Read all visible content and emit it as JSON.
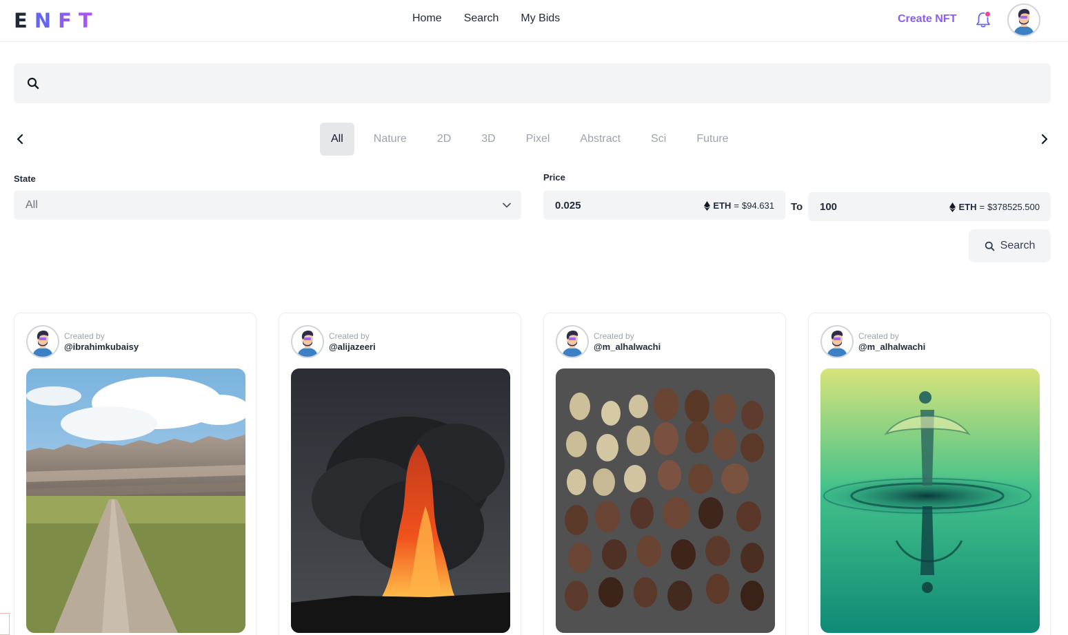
{
  "header": {
    "logo": {
      "letters": [
        "E",
        "N",
        "F",
        "T"
      ],
      "colors": [
        "#1f2937",
        "#6366f1",
        "#8b5cf6",
        "#a855f7"
      ]
    },
    "nav": [
      {
        "label": "Home"
      },
      {
        "label": "Search"
      },
      {
        "label": "My Bids"
      }
    ],
    "create_label": "Create NFT",
    "notification_icon": "bell-icon",
    "accent_color": "#8b5cf6"
  },
  "search": {
    "placeholder": "",
    "value": "",
    "icon": "search-icon"
  },
  "categories": {
    "items": [
      "All",
      "Nature",
      "2D",
      "3D",
      "Pixel",
      "Abstract",
      "Sci",
      "Future"
    ],
    "active": "All"
  },
  "filters": {
    "state_label": "State",
    "state_value": "All",
    "price_label": "Price",
    "price_from": {
      "value": "0.025",
      "currency": "ETH",
      "equals": "=",
      "usd": "$94.631"
    },
    "to_label": "To",
    "price_to": {
      "value": "100",
      "currency": "ETH",
      "equals": "=",
      "usd": "$378525.500"
    },
    "search_button": "Search"
  },
  "cards": [
    {
      "created_label": "Created by",
      "creator": "@ibrahimkubaisy",
      "image": "badlands-road"
    },
    {
      "created_label": "Created by",
      "creator": "@alijazeeri",
      "image": "volcano-eruption"
    },
    {
      "created_label": "Created by",
      "creator": "@m_alhalwachi",
      "image": "coffee-beans"
    },
    {
      "created_label": "Created by",
      "creator": "@m_alhalwachi",
      "image": "water-droplet"
    }
  ]
}
